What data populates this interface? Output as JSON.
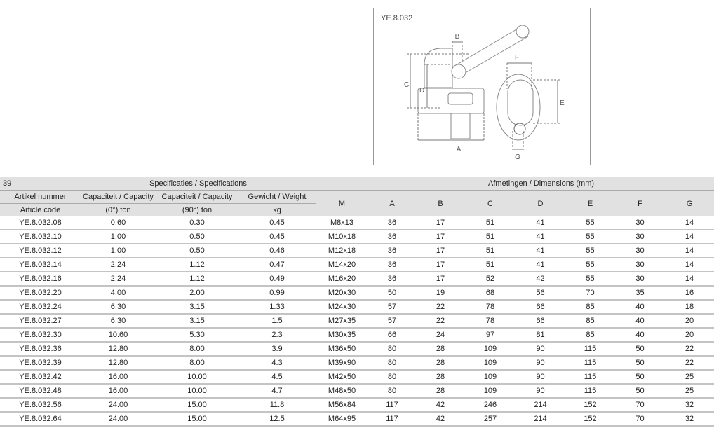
{
  "diagram": {
    "code": "YE.8.032",
    "labels": [
      "A",
      "B",
      "C",
      "D",
      "E",
      "F",
      "G"
    ]
  },
  "table": {
    "page_number": "39",
    "spec_group": "Specificaties / Specifications",
    "dim_group": "Afmetingen / Dimensions (mm)",
    "headers_top": [
      "Artikel nummer",
      "Capaciteit / Capacity",
      "Capaciteit / Capacity",
      "Gewicht / Weight"
    ],
    "headers_bottom": [
      "Article code",
      "(0°) ton",
      "(90°) ton",
      "kg"
    ],
    "dim_headers": [
      "M",
      "A",
      "B",
      "C",
      "D",
      "E",
      "F",
      "G"
    ],
    "rows": [
      [
        "YE.8.032.08",
        "0.60",
        "0.30",
        "0.45",
        "M8x13",
        "36",
        "17",
        "51",
        "41",
        "55",
        "30",
        "14"
      ],
      [
        "YE.8.032.10",
        "1.00",
        "0.50",
        "0.45",
        "M10x18",
        "36",
        "17",
        "51",
        "41",
        "55",
        "30",
        "14"
      ],
      [
        "YE.8.032.12",
        "1.00",
        "0.50",
        "0.46",
        "M12x18",
        "36",
        "17",
        "51",
        "41",
        "55",
        "30",
        "14"
      ],
      [
        "YE.8.032.14",
        "2.24",
        "1.12",
        "0.47",
        "M14x20",
        "36",
        "17",
        "51",
        "41",
        "55",
        "30",
        "14"
      ],
      [
        "YE.8.032.16",
        "2.24",
        "1.12",
        "0.49",
        "M16x20",
        "36",
        "17",
        "52",
        "42",
        "55",
        "30",
        "14"
      ],
      [
        "YE.8.032.20",
        "4.00",
        "2.00",
        "0.99",
        "M20x30",
        "50",
        "19",
        "68",
        "56",
        "70",
        "35",
        "16"
      ],
      [
        "YE.8.032.24",
        "6.30",
        "3.15",
        "1.33",
        "M24x30",
        "57",
        "22",
        "78",
        "66",
        "85",
        "40",
        "18"
      ],
      [
        "YE.8.032.27",
        "6.30",
        "3.15",
        "1.5",
        "M27x35",
        "57",
        "22",
        "78",
        "66",
        "85",
        "40",
        "20"
      ],
      [
        "YE.8.032.30",
        "10.60",
        "5.30",
        "2.3",
        "M30x35",
        "66",
        "24",
        "97",
        "81",
        "85",
        "40",
        "20"
      ],
      [
        "YE.8.032.36",
        "12.80",
        "8.00",
        "3.9",
        "M36x50",
        "80",
        "28",
        "109",
        "90",
        "115",
        "50",
        "22"
      ],
      [
        "YE.8.032.39",
        "12.80",
        "8.00",
        "4.3",
        "M39x90",
        "80",
        "28",
        "109",
        "90",
        "115",
        "50",
        "22"
      ],
      [
        "YE.8.032.42",
        "16.00",
        "10.00",
        "4.5",
        "M42x50",
        "80",
        "28",
        "109",
        "90",
        "115",
        "50",
        "25"
      ],
      [
        "YE.8.032.48",
        "16.00",
        "10.00",
        "4.7",
        "M48x50",
        "80",
        "28",
        "109",
        "90",
        "115",
        "50",
        "25"
      ],
      [
        "YE.8.032.56",
        "24.00",
        "15.00",
        "11.8",
        "M56x84",
        "117",
        "42",
        "246",
        "214",
        "152",
        "70",
        "32"
      ],
      [
        "YE.8.032.64",
        "24.00",
        "15.00",
        "12.5",
        "M64x95",
        "117",
        "42",
        "257",
        "214",
        "152",
        "70",
        "32"
      ]
    ]
  }
}
